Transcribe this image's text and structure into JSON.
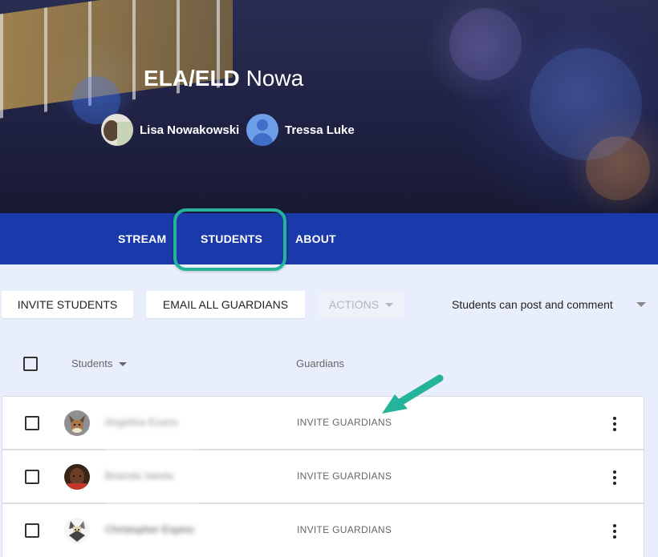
{
  "header": {
    "title_bold": "ELA/ELD",
    "title_rest": "Nowa",
    "teachers": [
      {
        "name": "Lisa Nowakowski"
      },
      {
        "name": "Tressa Luke"
      }
    ]
  },
  "tabs": [
    {
      "label": "STREAM"
    },
    {
      "label": "STUDENTS",
      "active": true
    },
    {
      "label": "ABOUT"
    }
  ],
  "toolbar": {
    "invite_students": "INVITE STUDENTS",
    "email_guardians": "EMAIL ALL GUARDIANS",
    "actions": "ACTIONS",
    "posting_setting": "Students can post and comment"
  },
  "table": {
    "students_header": "Students",
    "guardians_header": "Guardians",
    "rows": [
      {
        "name": "Angelina Evans",
        "guardian_action": "INVITE GUARDIANS",
        "avatar": "eevee"
      },
      {
        "name": "Brianda Varela",
        "guardian_action": "INVITE GUARDIANS",
        "avatar": "photo"
      },
      {
        "name": "Christopher Espino",
        "guardian_action": "INVITE GUARDIANS",
        "avatar": "character"
      }
    ]
  },
  "colors": {
    "tab_bar": "#1a3aab",
    "highlight": "#25b39a",
    "page_bg": "#e8eefb"
  }
}
